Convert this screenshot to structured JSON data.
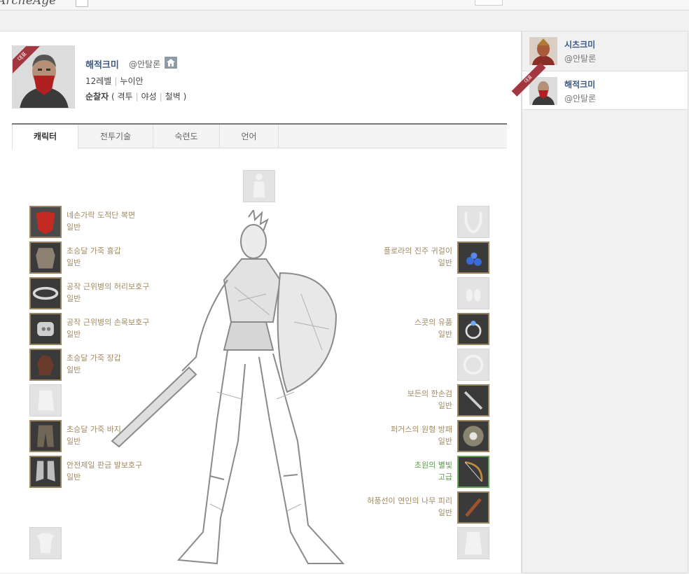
{
  "header": {
    "logo_text": "ArcheAge",
    "menu": [
      "",
      "",
      "",
      ""
    ]
  },
  "profile": {
    "name": "해적크미",
    "server": "@안탈론",
    "badge": "대표",
    "level": "12레벨",
    "race": "누이안",
    "class_name": "순찰자",
    "skills": [
      "격투",
      "야성",
      "철벽"
    ]
  },
  "tabs": [
    "캐릭터",
    "전투기술",
    "숙련도",
    "언어"
  ],
  "equipment_left": [
    {
      "name": "네손가락 도적단 복면",
      "grade": "일반"
    },
    {
      "name": "초승달 가죽 흉갑",
      "grade": "일반"
    },
    {
      "name": "공작 근위병의 허리보호구",
      "grade": "일반"
    },
    {
      "name": "공작 근위병의 손목보호구",
      "grade": "일반"
    },
    {
      "name": "초승달 가죽 장갑",
      "grade": "일반"
    },
    {
      "name": "초승달 가죽 바지",
      "grade": "일반"
    },
    {
      "name": "안전제일 판금 발보호구",
      "grade": "일반"
    }
  ],
  "equipment_right": [
    {
      "name": "플로라의 진주 귀걸이",
      "grade": "일반"
    },
    {
      "name": "스콧의 유품",
      "grade": "일반"
    },
    {
      "name": "보든의 한손검",
      "grade": "일반"
    },
    {
      "name": "퍼거스의 원형 방패",
      "grade": "일반"
    },
    {
      "name": "초원의 별빛",
      "grade": "고급"
    },
    {
      "name": "허풍선이 연인의 나무 피리",
      "grade": "일반"
    }
  ],
  "sidebar": {
    "characters": [
      {
        "name": "시츠크미",
        "server": "@안탈론"
      },
      {
        "name": "해적크미",
        "server": "@안탈론",
        "badge": "대표"
      }
    ]
  },
  "colors": {
    "name_blue": "#3b5a86",
    "item_normal": "#a08a63",
    "item_rare": "#5d9b4a",
    "badge_red": "#a3373f"
  }
}
